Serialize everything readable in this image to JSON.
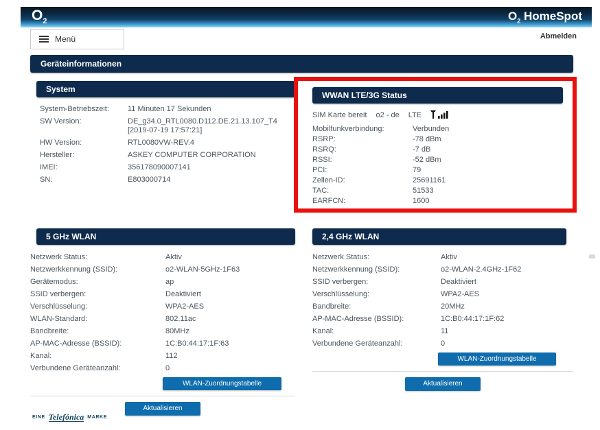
{
  "colors": {
    "navy": "#0e2b4d",
    "button-blue": "#0f6dad",
    "highlight-red": "#e8110d",
    "text": "#4a555e",
    "grad1": "#081723",
    "grad2": "#0c2a44",
    "grad3": "#12436b",
    "grad4": "#3b97cc",
    "grad5": "#8ed7f2"
  },
  "header": {
    "logo": {
      "o": "O",
      "sub": "2"
    },
    "product": {
      "o": "O",
      "sub": "2",
      "name": " HomeSpot"
    },
    "menu_label": "Menü",
    "logout_label": "Abmelden"
  },
  "page_title": "Geräteinformationen",
  "sections": {
    "system": {
      "title": "System",
      "rows": [
        {
          "label": "System-Betriebszeit:",
          "value": "11 Minuten 17 Sekunden"
        },
        {
          "label": "SW Version:",
          "value": "DE_g34.0_RTL0080.D112.DE.21.13.107_T4 [2019-07-19 17:57:21]"
        },
        {
          "label": "HW Version:",
          "value": "RTL0080VW-REV.4"
        },
        {
          "label": "Hersteller:",
          "value": "ASKEY COMPUTER CORPORATION"
        },
        {
          "label": "IMEI:",
          "value": "356178090007141"
        },
        {
          "label": "SN:",
          "value": "E803000714"
        }
      ]
    },
    "wwan": {
      "title": "WWAN LTE/3G Status",
      "sim_status": "SIM Karte bereit",
      "operator": "o2 - de",
      "network_type": "LTE",
      "signal_icon": "signal-strength-icon",
      "rows": [
        {
          "label": "Mobilfunkverbindung:",
          "value": "Verbunden"
        },
        {
          "label": "RSRP:",
          "value": "-78 dBm"
        },
        {
          "label": "RSRQ:",
          "value": "-7 dB"
        },
        {
          "label": "RSSI:",
          "value": "-52 dBm"
        },
        {
          "label": "PCI:",
          "value": "79"
        },
        {
          "label": "Zellen-ID:",
          "value": "25691161"
        },
        {
          "label": "TAC:",
          "value": "51533"
        },
        {
          "label": "EARFCN:",
          "value": "1600"
        }
      ]
    },
    "wlan5": {
      "title": "5 GHz WLAN",
      "rows": [
        {
          "label": "Netzwerk Status:",
          "value": "Aktiv"
        },
        {
          "label": "Netzwerkkennung (SSID):",
          "value": "o2-WLAN-5GHz-1F63"
        },
        {
          "label": "Gerätemodus:",
          "value": "ap"
        },
        {
          "label": "SSID verbergen:",
          "value": "Deaktiviert"
        },
        {
          "label": "Verschlüsselung:",
          "value": "WPA2-AES"
        },
        {
          "label": "WLAN-Standard:",
          "value": "802.11ac"
        },
        {
          "label": "Bandbreite:",
          "value": "80MHz"
        },
        {
          "label": "AP-MAC-Adresse (BSSID):",
          "value": "1C:B0:44:17:1F:63"
        },
        {
          "label": "Kanal:",
          "value": "112"
        },
        {
          "label": "Verbundene Geräteanzahl:",
          "value": "0"
        }
      ],
      "table_button": "WLAN-Zuordnungstabelle",
      "refresh_button": "Aktualisieren"
    },
    "wlan24": {
      "title": "2,4 GHz WLAN",
      "rows": [
        {
          "label": "Netzwerk Status:",
          "value": "Aktiv"
        },
        {
          "label": "Netzwerkkennung (SSID):",
          "value": "o2-WLAN-2.4GHz-1F62"
        },
        {
          "label": "SSID verbergen:",
          "value": "Deaktiviert"
        },
        {
          "label": "Verschlüsselung:",
          "value": "WPA2-AES"
        },
        {
          "label": "Bandbreite:",
          "value": "20MHz"
        },
        {
          "label": "AP-MAC-Adresse (BSSID):",
          "value": "1C:B0:44:17:1F:62"
        },
        {
          "label": "Kanal:",
          "value": "11"
        },
        {
          "label": "Verbundene Geräteanzahl:",
          "value": "0"
        }
      ],
      "table_button": "WLAN-Zuordnungstabelle",
      "refresh_button": "Aktualisieren"
    }
  },
  "footer": {
    "prefix": "EINE",
    "brand": "Telefónica",
    "suffix": "MARKE"
  }
}
